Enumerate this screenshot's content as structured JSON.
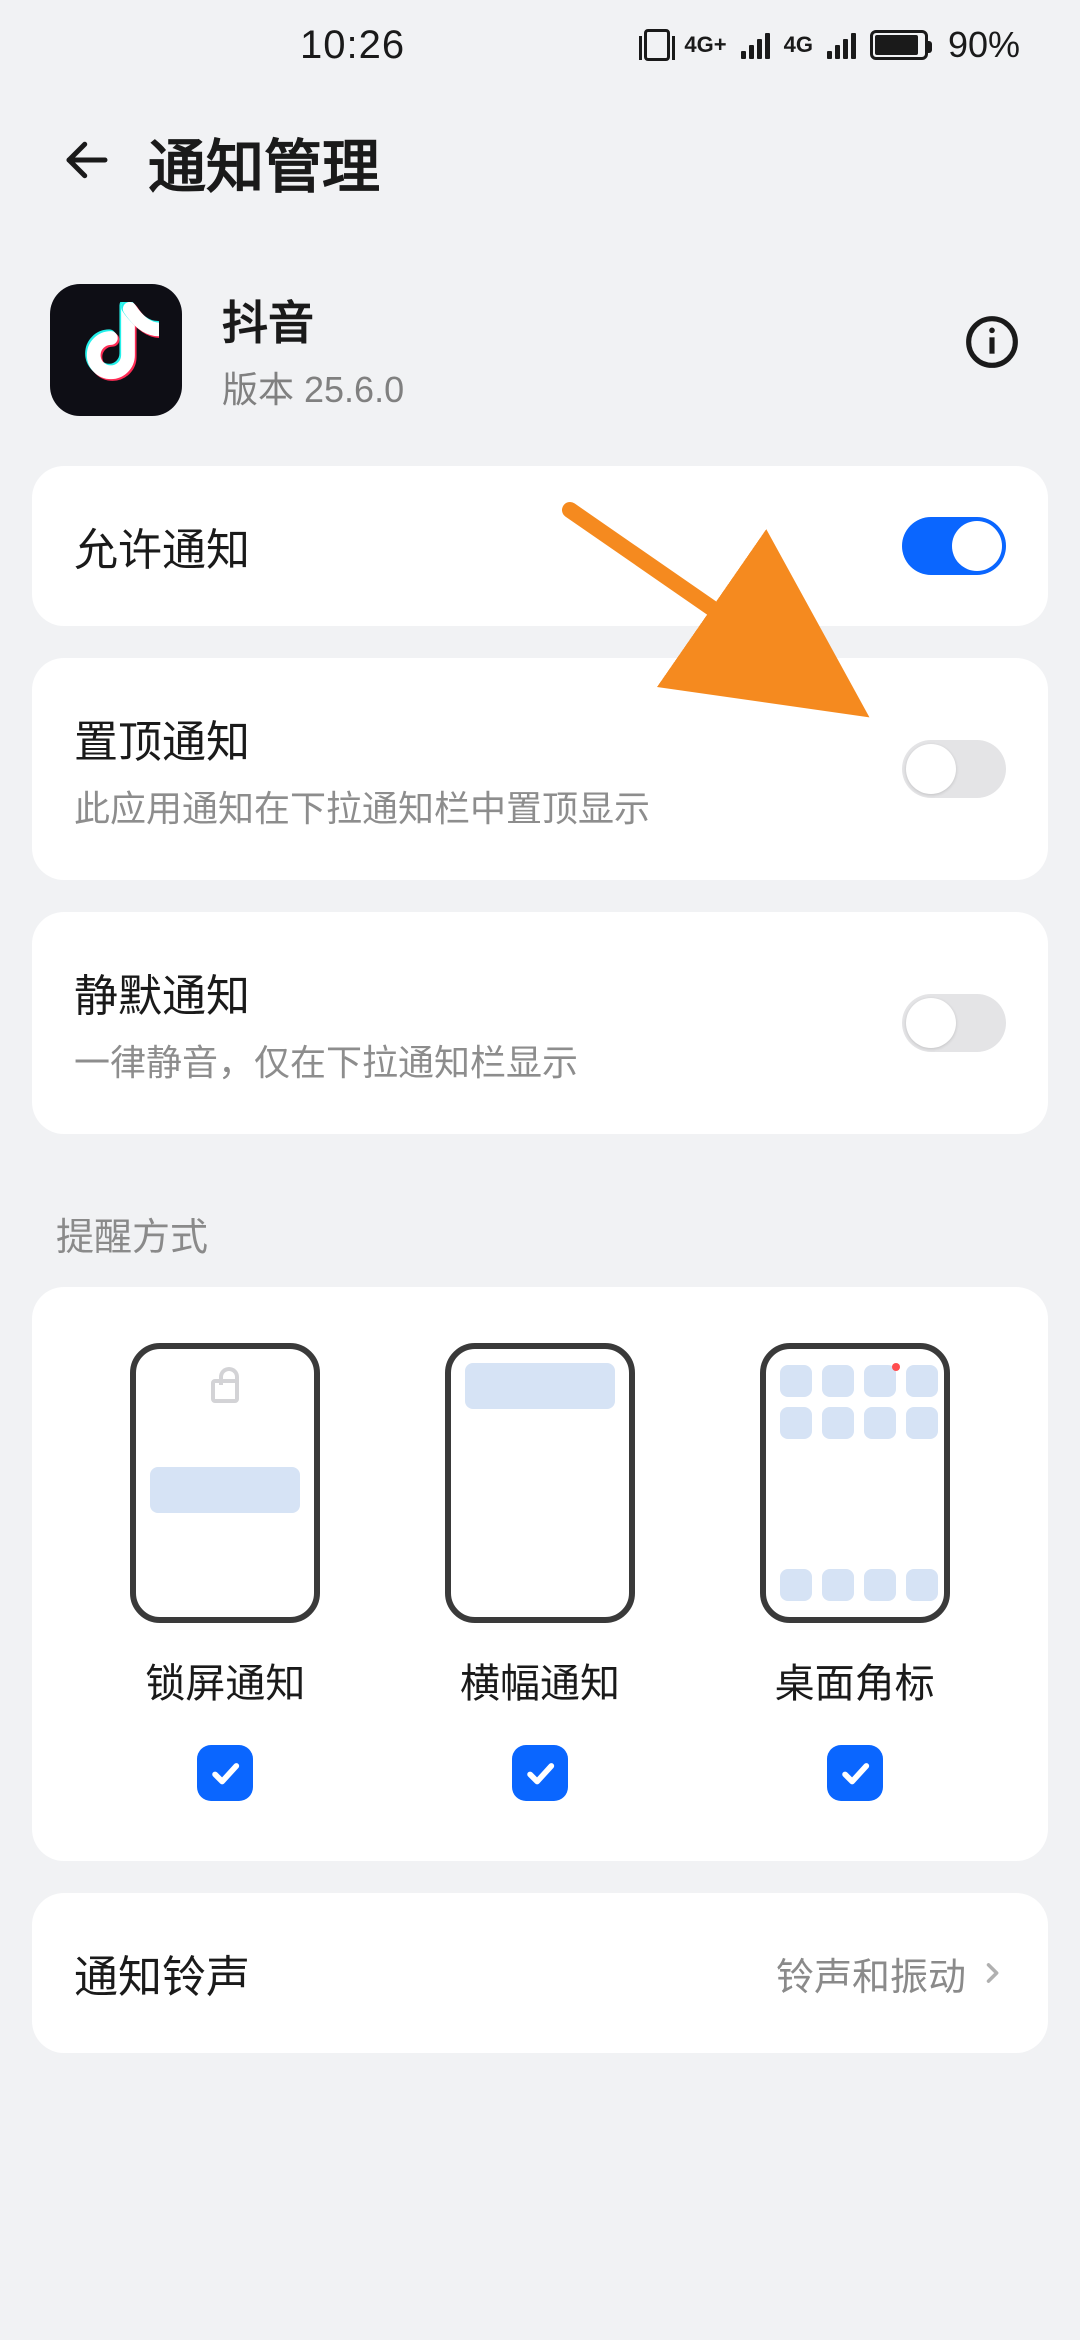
{
  "status": {
    "time": "10:26",
    "net1": "4G+",
    "net2": "4G",
    "battery_pct": "90%"
  },
  "header": {
    "title": "通知管理"
  },
  "app": {
    "name": "抖音",
    "version_label": "版本 25.6.0"
  },
  "toggles": {
    "allow": {
      "title": "允许通知",
      "on": true
    },
    "pin": {
      "title": "置顶通知",
      "sub": "此应用通知在下拉通知栏中置顶显示",
      "on": false
    },
    "silent": {
      "title": "静默通知",
      "sub": "一律静音，仅在下拉通知栏显示",
      "on": false
    }
  },
  "section_reminder": "提醒方式",
  "modes": {
    "lock": {
      "label": "锁屏通知",
      "checked": true
    },
    "banner": {
      "label": "横幅通知",
      "checked": true
    },
    "badge": {
      "label": "桌面角标",
      "checked": true
    }
  },
  "ringtone": {
    "title": "通知铃声",
    "value": "铃声和振动"
  },
  "colors": {
    "accent": "#0a66ff",
    "arrow": "#f58a1f"
  }
}
